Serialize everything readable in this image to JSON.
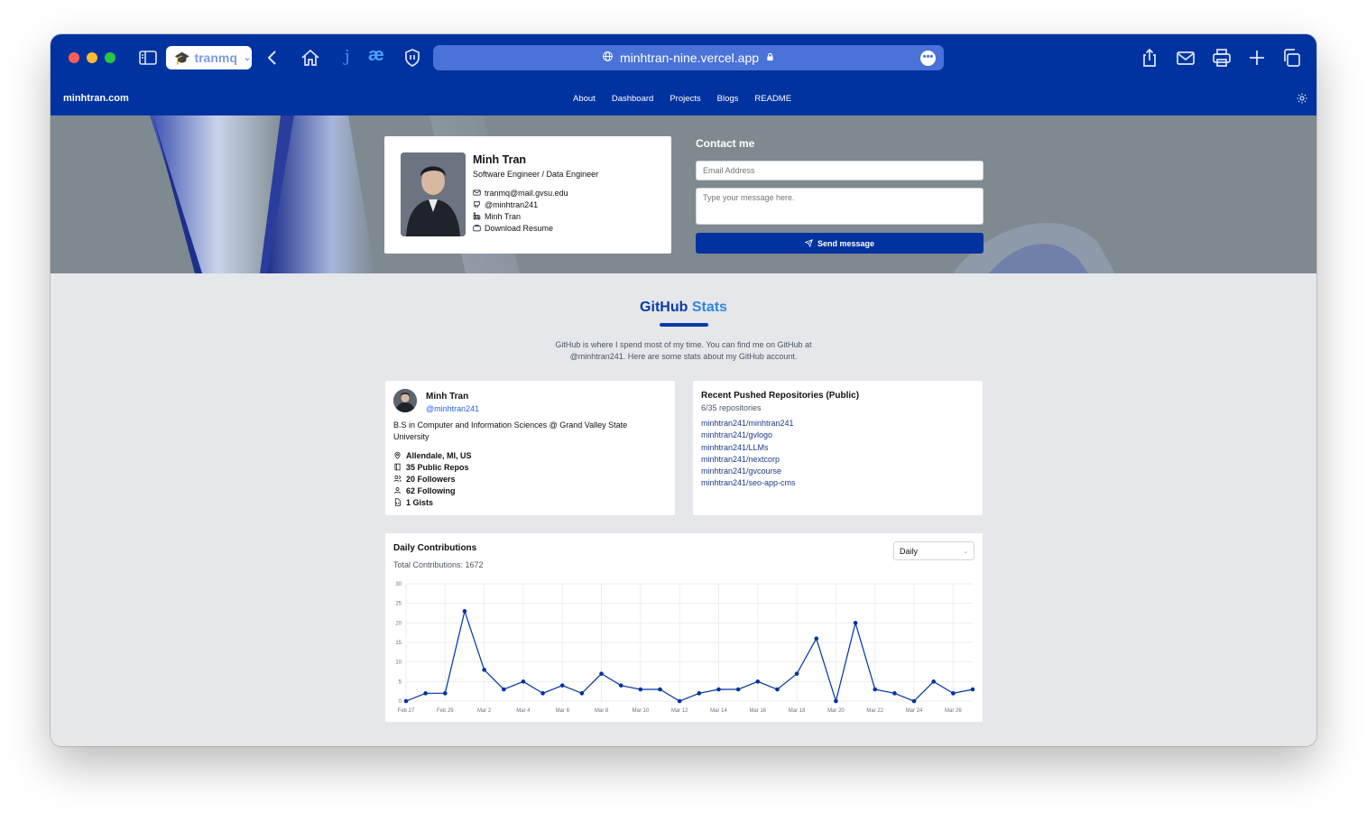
{
  "browser": {
    "tab_group": "tranmq",
    "url": "minhtran-nine.vercel.app"
  },
  "nav": {
    "brand": "minhtran.com",
    "links": [
      "About",
      "Dashboard",
      "Projects",
      "Blogs",
      "README"
    ]
  },
  "profile": {
    "name": "Minh Tran",
    "title": "Software Engineer / Data Engineer",
    "email": "tranmq@mail.gvsu.edu",
    "github": "@minhtran241",
    "linkedin": "Minh Tran",
    "resume": "Download Resume"
  },
  "contact": {
    "heading": "Contact me",
    "email_placeholder": "Email Address",
    "message_placeholder": "Type your message here.",
    "send_label": "Send message"
  },
  "github": {
    "title_word1": "GitHub",
    "title_word2": "Stats",
    "description": "GitHub is where I spend most of my time. You can find me on GitHub at @minhtran241. Here are some stats about my GitHub account.",
    "user": {
      "name": "Minh Tran",
      "handle": "@minhtran241",
      "bio": "B.S in Computer and Information Sciences @ Grand Valley State University",
      "location": "Allendale, MI, US",
      "repos": "35 Public Repos",
      "followers": "20 Followers",
      "following": "62 Following",
      "gists": "1 Gists"
    },
    "repos": {
      "title": "Recent Pushed Repositories (Public)",
      "count": "6/35 repositories",
      "items": [
        "minhtran241/minhtran241",
        "minhtran241/gvlogo",
        "minhtran241/LLMs",
        "minhtran241/nextcorp",
        "minhtran241/gvcourse",
        "minhtran241/seo-app-cms"
      ]
    },
    "contributions": {
      "title": "Daily Contributions",
      "total": "Total Contributions: 1672",
      "period": "Daily"
    }
  },
  "chart_data": {
    "type": "line",
    "x_tick_labels": [
      "Feb 27",
      "Feb 29",
      "Mar 2",
      "Mar 4",
      "Mar 6",
      "Mar 8",
      "Mar 10",
      "Mar 12",
      "Mar 14",
      "Mar 16",
      "Mar 18",
      "Mar 20",
      "Mar 22",
      "Mar 24",
      "Mar 26"
    ],
    "x": [
      "Feb 27",
      "Feb 28",
      "Feb 29",
      "Mar 1",
      "Mar 2",
      "Mar 3",
      "Mar 4",
      "Mar 5",
      "Mar 6",
      "Mar 7",
      "Mar 8",
      "Mar 9",
      "Mar 10",
      "Mar 11",
      "Mar 12",
      "Mar 13",
      "Mar 14",
      "Mar 15",
      "Mar 16",
      "Mar 17",
      "Mar 18",
      "Mar 19",
      "Mar 20",
      "Mar 21",
      "Mar 22",
      "Mar 23",
      "Mar 24",
      "Mar 25",
      "Mar 26",
      "Mar 27"
    ],
    "values": [
      0,
      2,
      2,
      23,
      8,
      3,
      5,
      2,
      4,
      2,
      7,
      4,
      3,
      3,
      0,
      2,
      3,
      3,
      5,
      3,
      7,
      16,
      0,
      20,
      3,
      2,
      0,
      5,
      2,
      3
    ],
    "y_ticks": [
      0,
      5,
      10,
      15,
      20,
      25,
      30
    ],
    "ylim": [
      0,
      30
    ],
    "grid": true,
    "color": "#0033a0"
  }
}
